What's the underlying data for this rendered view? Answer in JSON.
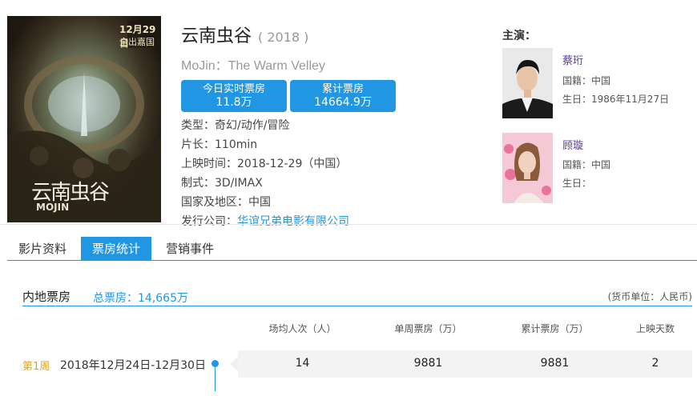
{
  "movie": {
    "title": "云南虫谷",
    "year": "( 2018 )",
    "en_title": "MoJin：The Warm Velley",
    "poster_date": "12月29日",
    "poster_release": "全出嘉国",
    "poster_title": "云南虫谷",
    "poster_en": "MOJIN",
    "today_label": "今日实时票房",
    "today_value": "11.8万",
    "total_label": "累计票房",
    "total_value": "14664.9万",
    "genre": "类型：奇幻/动作/冒险",
    "duration": "片长：110min",
    "release": "上映时间：2018-12-29（中国）",
    "format": "制式：3D/IMAX",
    "region": "国家及地区：中国",
    "distributor_label": "发行公司：",
    "distributor": "华谊兄弟电影有限公司"
  },
  "cast": {
    "heading": "主演：",
    "actors": [
      {
        "name": "蔡珩",
        "nationality": "国籍：中国",
        "birthday": "生日：1986年11月27日"
      },
      {
        "name": "顾璇",
        "nationality": "国籍：中国",
        "birthday": "生日："
      }
    ]
  },
  "tabs": [
    "影片资料",
    "票房统计",
    "营销事件"
  ],
  "box_office": {
    "title": "内地票房",
    "total": "总票房：14,665万",
    "unit": "(货币单位：人民币)",
    "columns": [
      "场均人次（人）",
      "单周票房（万）",
      "累计票房（万）",
      "上映天数"
    ],
    "rows": [
      {
        "week": "第1周",
        "range": "2018年12月24日-12月30日",
        "avg_attendance": "14",
        "weekly": "9881",
        "cumulative": "9881",
        "days": "2"
      }
    ]
  },
  "colors": {
    "accent": "#2196e3",
    "week": "#e3a21a",
    "actor_name": "#5b3aa6"
  }
}
